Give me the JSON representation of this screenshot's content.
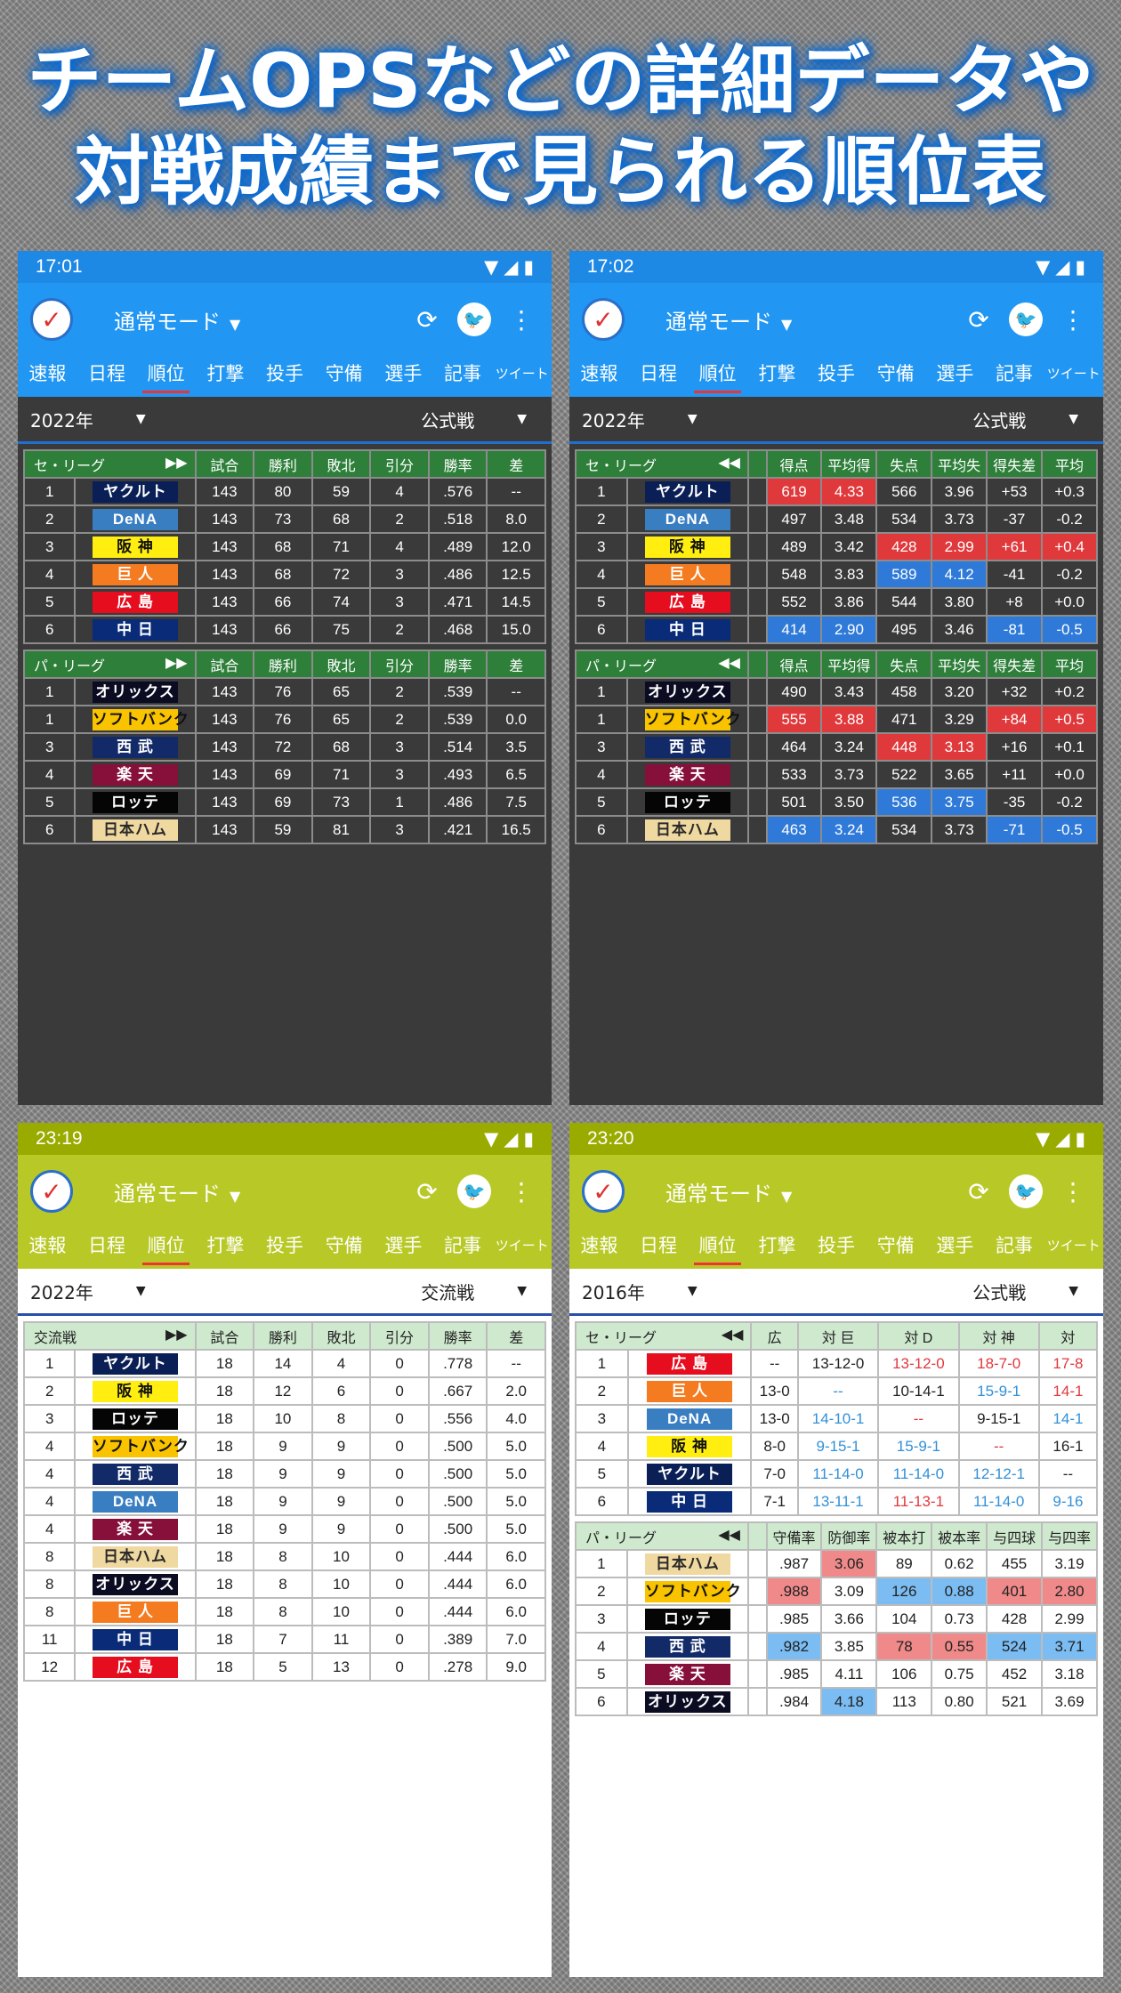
{
  "headline": {
    "line1": "チームOPSなどの詳細データや",
    "line2": "対戦成績まで見られる順位表"
  },
  "common": {
    "mode": "通常モード",
    "tabs": [
      "速報",
      "日程",
      "順位",
      "打撃",
      "投手",
      "守備",
      "選手",
      "記事",
      "ツイート"
    ]
  },
  "teams": {
    "yakult": {
      "name": "ヤクルト",
      "bg": "#0a1f55",
      "fg": "#ffffff"
    },
    "dena": {
      "name": "DeNA",
      "bg": "#3a7ec2",
      "fg": "#ffffff"
    },
    "hanshin": {
      "name": "阪 神",
      "bg": "#ffee10",
      "fg": "#111111"
    },
    "kyojin": {
      "name": "巨 人",
      "bg": "#f47b20",
      "fg": "#ffffff"
    },
    "hiroshima": {
      "name": "広 島",
      "bg": "#e60d1e",
      "fg": "#ffffff"
    },
    "chunichi": {
      "name": "中 日",
      "bg": "#0a2c78",
      "fg": "#ffffff"
    },
    "orix": {
      "name": "オリックス",
      "bg": "#0b0b22",
      "fg": "#ffffff"
    },
    "softbank": {
      "name": "ソフトバンク",
      "bg": "#f9c300",
      "fg": "#111111"
    },
    "seibu": {
      "name": "西 武",
      "bg": "#132a68",
      "fg": "#ffffff"
    },
    "rakuten": {
      "name": "楽 天",
      "bg": "#86103a",
      "fg": "#ffffff"
    },
    "lotte": {
      "name": "ロッテ",
      "bg": "#050505",
      "fg": "#ffffff"
    },
    "nippon": {
      "name": "日本ハム",
      "bg": "#f0d9a0",
      "fg": "#2a2a2a"
    }
  },
  "phones": [
    {
      "time": "17:01",
      "theme": "dark",
      "bar": "#1e88e5",
      "appbar": "#2196f3",
      "year": "2022年",
      "category": "公式戦",
      "tables": [
        {
          "kind": "standings",
          "league": "セ・リーグ",
          "nav": "▶▶",
          "headers": [
            "試合",
            "勝利",
            "敗北",
            "引分",
            "勝率",
            "差"
          ],
          "rows": [
            [
              "1",
              "yakult",
              "143",
              "80",
              "59",
              "4",
              ".576",
              "--"
            ],
            [
              "2",
              "dena",
              "143",
              "73",
              "68",
              "2",
              ".518",
              "8.0"
            ],
            [
              "3",
              "hanshin",
              "143",
              "68",
              "71",
              "4",
              ".489",
              "12.0"
            ],
            [
              "4",
              "kyojin",
              "143",
              "68",
              "72",
              "3",
              ".486",
              "12.5"
            ],
            [
              "5",
              "hiroshima",
              "143",
              "66",
              "74",
              "3",
              ".471",
              "14.5"
            ],
            [
              "6",
              "chunichi",
              "143",
              "66",
              "75",
              "2",
              ".468",
              "15.0"
            ]
          ]
        },
        {
          "kind": "standings",
          "league": "パ・リーグ",
          "nav": "▶▶",
          "headers": [
            "試合",
            "勝利",
            "敗北",
            "引分",
            "勝率",
            "差"
          ],
          "rows": [
            [
              "1",
              "orix",
              "143",
              "76",
              "65",
              "2",
              ".539",
              "--"
            ],
            [
              "1",
              "softbank",
              "143",
              "76",
              "65",
              "2",
              ".539",
              "0.0"
            ],
            [
              "3",
              "seibu",
              "143",
              "72",
              "68",
              "3",
              ".514",
              "3.5"
            ],
            [
              "4",
              "rakuten",
              "143",
              "69",
              "71",
              "3",
              ".493",
              "6.5"
            ],
            [
              "5",
              "lotte",
              "143",
              "69",
              "73",
              "1",
              ".486",
              "7.5"
            ],
            [
              "6",
              "nippon",
              "143",
              "59",
              "81",
              "3",
              ".421",
              "16.5"
            ]
          ]
        }
      ]
    },
    {
      "time": "17:02",
      "theme": "dark",
      "bar": "#1e88e5",
      "appbar": "#2196f3",
      "year": "2022年",
      "category": "公式戦",
      "tables": [
        {
          "kind": "stats",
          "league": "セ・リーグ",
          "nav": "◀◀",
          "headers": [
            "得点",
            "平均得",
            "失点",
            "平均失",
            "得失差",
            "平均"
          ],
          "rows": [
            [
              "1",
              "yakult",
              "619",
              "4.33",
              "566",
              "3.96",
              "+53",
              "+0.3"
            ],
            [
              "2",
              "dena",
              "497",
              "3.48",
              "534",
              "3.73",
              "-37",
              "-0.2"
            ],
            [
              "3",
              "hanshin",
              "489",
              "3.42",
              "428",
              "2.99",
              "+61",
              "+0.4"
            ],
            [
              "4",
              "kyojin",
              "548",
              "3.83",
              "589",
              "4.12",
              "-41",
              "-0.2"
            ],
            [
              "5",
              "hiroshima",
              "552",
              "3.86",
              "544",
              "3.80",
              "+8",
              "+0.0"
            ],
            [
              "6",
              "chunichi",
              "414",
              "2.90",
              "495",
              "3.46",
              "-81",
              "-0.5"
            ]
          ],
          "hl": {
            "0-0": "red",
            "0-1": "red",
            "2-2": "red",
            "2-3": "red",
            "2-4": "red",
            "2-5": "red",
            "3-2": "blue",
            "3-3": "blue",
            "5-0": "blue",
            "5-1": "blue",
            "5-4": "blue",
            "5-5": "blue"
          }
        },
        {
          "kind": "stats",
          "league": "パ・リーグ",
          "nav": "◀◀",
          "headers": [
            "得点",
            "平均得",
            "失点",
            "平均失",
            "得失差",
            "平均"
          ],
          "rows": [
            [
              "1",
              "orix",
              "490",
              "3.43",
              "458",
              "3.20",
              "+32",
              "+0.2"
            ],
            [
              "1",
              "softbank",
              "555",
              "3.88",
              "471",
              "3.29",
              "+84",
              "+0.5"
            ],
            [
              "3",
              "seibu",
              "464",
              "3.24",
              "448",
              "3.13",
              "+16",
              "+0.1"
            ],
            [
              "4",
              "rakuten",
              "533",
              "3.73",
              "522",
              "3.65",
              "+11",
              "+0.0"
            ],
            [
              "5",
              "lotte",
              "501",
              "3.50",
              "536",
              "3.75",
              "-35",
              "-0.2"
            ],
            [
              "6",
              "nippon",
              "463",
              "3.24",
              "534",
              "3.73",
              "-71",
              "-0.5"
            ]
          ],
          "hl": {
            "1-0": "red",
            "1-1": "red",
            "1-4": "red",
            "1-5": "red",
            "2-2": "red",
            "2-3": "red",
            "4-2": "blue",
            "4-3": "blue",
            "5-0": "blue",
            "5-1": "blue",
            "5-4": "blue",
            "5-5": "blue"
          }
        }
      ]
    },
    {
      "time": "23:19",
      "theme": "light",
      "bar": "#9aab00",
      "appbar": "#b8c927",
      "year": "2022年",
      "category": "交流戦",
      "tables": [
        {
          "kind": "standings",
          "league": "交流戦",
          "nav": "▶▶",
          "headers": [
            "試合",
            "勝利",
            "敗北",
            "引分",
            "勝率",
            "差"
          ],
          "rows": [
            [
              "1",
              "yakult",
              "18",
              "14",
              "4",
              "0",
              ".778",
              "--"
            ],
            [
              "2",
              "hanshin",
              "18",
              "12",
              "6",
              "0",
              ".667",
              "2.0"
            ],
            [
              "3",
              "lotte",
              "18",
              "10",
              "8",
              "0",
              ".556",
              "4.0"
            ],
            [
              "4",
              "softbank",
              "18",
              "9",
              "9",
              "0",
              ".500",
              "5.0"
            ],
            [
              "4",
              "seibu",
              "18",
              "9",
              "9",
              "0",
              ".500",
              "5.0"
            ],
            [
              "4",
              "dena",
              "18",
              "9",
              "9",
              "0",
              ".500",
              "5.0"
            ],
            [
              "4",
              "rakuten",
              "18",
              "9",
              "9",
              "0",
              ".500",
              "5.0"
            ],
            [
              "8",
              "nippon",
              "18",
              "8",
              "10",
              "0",
              ".444",
              "6.0"
            ],
            [
              "8",
              "orix",
              "18",
              "8",
              "10",
              "0",
              ".444",
              "6.0"
            ],
            [
              "8",
              "kyojin",
              "18",
              "8",
              "10",
              "0",
              ".444",
              "6.0"
            ],
            [
              "11",
              "chunichi",
              "18",
              "7",
              "11",
              "0",
              ".389",
              "7.0"
            ],
            [
              "12",
              "hiroshima",
              "18",
              "5",
              "13",
              "0",
              ".278",
              "9.0"
            ]
          ]
        }
      ]
    },
    {
      "time": "23:20",
      "theme": "light",
      "bar": "#9aab00",
      "appbar": "#b8c927",
      "year": "2016年",
      "category": "公式戦",
      "tables": [
        {
          "kind": "vs",
          "league": "セ・リーグ",
          "nav": "◀◀",
          "headers": [
            "広",
            "対 巨",
            "対 D",
            "対 神",
            "対"
          ],
          "rows": [
            [
              "1",
              "hiroshima",
              "--",
              "13-12-0",
              "13-12-0",
              "18-7-0",
              "17-8"
            ],
            [
              "2",
              "kyojin",
              "13-0",
              "--",
              "10-14-1",
              "15-9-1",
              "14-1"
            ],
            [
              "3",
              "dena",
              "13-0",
              "14-10-1",
              "--",
              "9-15-1",
              "14-1"
            ],
            [
              "4",
              "hanshin",
              "8-0",
              "9-15-1",
              "15-9-1",
              "--",
              "16-1"
            ],
            [
              "5",
              "yakult",
              "7-0",
              "11-14-0",
              "11-14-0",
              "12-12-1",
              "--"
            ],
            [
              "6",
              "chunichi",
              "7-1",
              "13-11-1",
              "11-13-1",
              "11-14-0",
              "9-16"
            ]
          ],
          "tc": {
            "0-2": "r",
            "0-3": "r",
            "0-4": "r",
            "0-5": "r",
            "1-1": "b",
            "1-3": "b",
            "1-4": "r",
            "1-5": "r",
            "2-1": "b",
            "2-2": "r",
            "2-4": "b",
            "2-5": "r",
            "3-1": "b",
            "3-2": "b",
            "3-3": "r",
            "3-5": "r",
            "4-1": "b",
            "4-2": "b",
            "4-3": "b",
            "5-1": "b",
            "5-2": "r",
            "5-3": "b",
            "5-4": "b",
            "5-5": "b"
          }
        },
        {
          "kind": "stats",
          "league": "パ・リーグ",
          "nav": "◀◀",
          "headers": [
            "守備率",
            "防御率",
            "被本打",
            "被本率",
            "与四球",
            "与四率"
          ],
          "rows": [
            [
              "1",
              "nippon",
              ".987",
              "3.06",
              "89",
              "0.62",
              "455",
              "3.19"
            ],
            [
              "2",
              "softbank",
              ".988",
              "3.09",
              "126",
              "0.88",
              "401",
              "2.80"
            ],
            [
              "3",
              "lotte",
              ".985",
              "3.66",
              "104",
              "0.73",
              "428",
              "2.99"
            ],
            [
              "4",
              "seibu",
              ".982",
              "3.85",
              "78",
              "0.55",
              "524",
              "3.71"
            ],
            [
              "5",
              "rakuten",
              ".985",
              "4.11",
              "106",
              "0.75",
              "452",
              "3.18"
            ],
            [
              "6",
              "orix",
              ".984",
              "4.18",
              "113",
              "0.80",
              "521",
              "3.69"
            ]
          ],
          "hl": {
            "0-1": "lred",
            "1-0": "lred",
            "1-2": "lblue",
            "1-3": "lblue",
            "1-4": "lred",
            "1-5": "lred",
            "3-0": "lblue",
            "3-2": "lred",
            "3-3": "lred",
            "3-4": "lblue",
            "3-5": "lblue",
            "5-1": "lblue"
          }
        }
      ]
    }
  ]
}
